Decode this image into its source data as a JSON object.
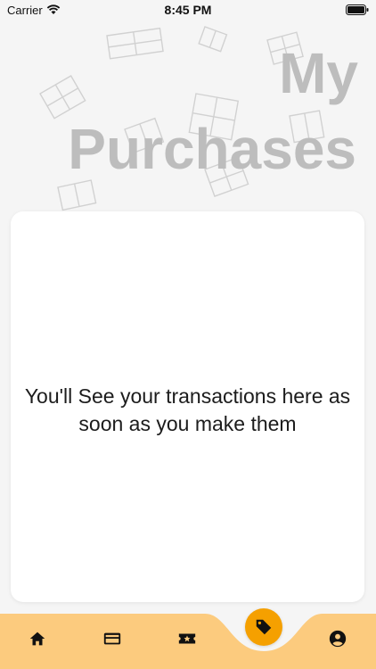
{
  "status_bar": {
    "carrier": "Carrier",
    "time": "8:45 PM"
  },
  "header": {
    "title_line1": "My",
    "title_line2": "Purchases"
  },
  "main": {
    "empty_message": "You'll See your transactions here as soon as you make them"
  },
  "tab_bar": {
    "tabs": [
      {
        "icon": "home-icon"
      },
      {
        "icon": "card-icon"
      },
      {
        "icon": "ticket-icon"
      },
      {
        "icon": "tag-icon",
        "active": true
      },
      {
        "icon": "profile-icon"
      }
    ],
    "bar_color": "#fccb7e",
    "active_color": "#f5a000"
  }
}
